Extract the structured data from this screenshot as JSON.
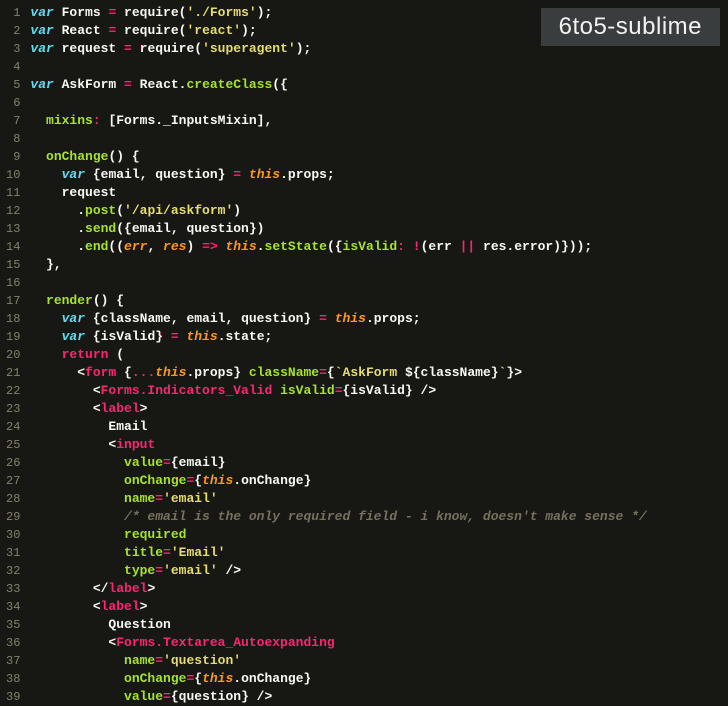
{
  "badge": "6to5-sublime",
  "lines": [
    {
      "n": 1,
      "tokens": [
        [
          "st",
          "var "
        ],
        [
          "nm",
          "Forms "
        ],
        [
          "op",
          "="
        ],
        [
          "nm",
          " require("
        ],
        [
          "str",
          "'./Forms'"
        ],
        [
          "nm",
          ");"
        ]
      ]
    },
    {
      "n": 2,
      "tokens": [
        [
          "st",
          "var "
        ],
        [
          "nm",
          "React "
        ],
        [
          "op",
          "="
        ],
        [
          "nm",
          " require("
        ],
        [
          "str",
          "'react'"
        ],
        [
          "nm",
          ");"
        ]
      ]
    },
    {
      "n": 3,
      "tokens": [
        [
          "st",
          "var "
        ],
        [
          "nm",
          "request "
        ],
        [
          "op",
          "="
        ],
        [
          "nm",
          " require("
        ],
        [
          "str",
          "'superagent'"
        ],
        [
          "nm",
          ");"
        ]
      ]
    },
    {
      "n": 4,
      "tokens": [
        [
          "nm",
          ""
        ]
      ]
    },
    {
      "n": 5,
      "tokens": [
        [
          "st",
          "var "
        ],
        [
          "nm",
          "AskForm "
        ],
        [
          "op",
          "="
        ],
        [
          "nm",
          " React."
        ],
        [
          "fn",
          "createClass"
        ],
        [
          "nm",
          "({"
        ]
      ]
    },
    {
      "n": 6,
      "tokens": [
        [
          "nm",
          ""
        ]
      ]
    },
    {
      "n": 7,
      "tokens": [
        [
          "nm",
          "  "
        ],
        [
          "fn",
          "mixins"
        ],
        [
          "op",
          ":"
        ],
        [
          "nm",
          " [Forms._InputsMixin],"
        ]
      ]
    },
    {
      "n": 8,
      "tokens": [
        [
          "nm",
          ""
        ]
      ]
    },
    {
      "n": 9,
      "tokens": [
        [
          "nm",
          "  "
        ],
        [
          "fn",
          "onChange"
        ],
        [
          "nm",
          "() {"
        ]
      ]
    },
    {
      "n": 10,
      "tokens": [
        [
          "nm",
          "    "
        ],
        [
          "st",
          "var "
        ],
        [
          "nm",
          "{email, question} "
        ],
        [
          "op",
          "="
        ],
        [
          "nm",
          " "
        ],
        [
          "thiskw",
          "this"
        ],
        [
          "nm",
          ".props;"
        ]
      ]
    },
    {
      "n": 11,
      "tokens": [
        [
          "nm",
          "    request"
        ]
      ]
    },
    {
      "n": 12,
      "tokens": [
        [
          "nm",
          "      ."
        ],
        [
          "fn",
          "post"
        ],
        [
          "nm",
          "("
        ],
        [
          "str",
          "'/api/askform'"
        ],
        [
          "nm",
          ")"
        ]
      ]
    },
    {
      "n": 13,
      "tokens": [
        [
          "nm",
          "      ."
        ],
        [
          "fn",
          "send"
        ],
        [
          "nm",
          "({email, question})"
        ]
      ]
    },
    {
      "n": 14,
      "tokens": [
        [
          "nm",
          "      ."
        ],
        [
          "fn",
          "end"
        ],
        [
          "nm",
          "(("
        ],
        [
          "thiskw",
          "err"
        ],
        [
          "nm",
          ", "
        ],
        [
          "thiskw",
          "res"
        ],
        [
          "nm",
          ") "
        ],
        [
          "op",
          "=>"
        ],
        [
          "nm",
          " "
        ],
        [
          "thiskw",
          "this"
        ],
        [
          "nm",
          "."
        ],
        [
          "fn",
          "setState"
        ],
        [
          "nm",
          "({"
        ],
        [
          "fn",
          "isValid"
        ],
        [
          "op",
          ":"
        ],
        [
          "nm",
          " "
        ],
        [
          "op",
          "!"
        ],
        [
          "nm",
          "(err "
        ],
        [
          "op",
          "||"
        ],
        [
          "nm",
          " res.error)}));"
        ]
      ]
    },
    {
      "n": 15,
      "tokens": [
        [
          "nm",
          "  },"
        ]
      ]
    },
    {
      "n": 16,
      "tokens": [
        [
          "nm",
          ""
        ]
      ]
    },
    {
      "n": 17,
      "tokens": [
        [
          "nm",
          "  "
        ],
        [
          "fn",
          "render"
        ],
        [
          "nm",
          "() {"
        ]
      ]
    },
    {
      "n": 18,
      "tokens": [
        [
          "nm",
          "    "
        ],
        [
          "st",
          "var "
        ],
        [
          "nm",
          "{className, email, question} "
        ],
        [
          "op",
          "="
        ],
        [
          "nm",
          " "
        ],
        [
          "thiskw",
          "this"
        ],
        [
          "nm",
          ".props;"
        ]
      ]
    },
    {
      "n": 19,
      "tokens": [
        [
          "nm",
          "    "
        ],
        [
          "st",
          "var "
        ],
        [
          "nm",
          "{isValid} "
        ],
        [
          "op",
          "="
        ],
        [
          "nm",
          " "
        ],
        [
          "thiskw",
          "this"
        ],
        [
          "nm",
          ".state;"
        ]
      ]
    },
    {
      "n": 20,
      "tokens": [
        [
          "nm",
          "    "
        ],
        [
          "op",
          "return"
        ],
        [
          "nm",
          " ("
        ]
      ]
    },
    {
      "n": 21,
      "tokens": [
        [
          "nm",
          "      <"
        ],
        [
          "tag",
          "form"
        ],
        [
          "nm",
          " {"
        ],
        [
          "op",
          "..."
        ],
        [
          "thiskw",
          "this"
        ],
        [
          "nm",
          ".props} "
        ],
        [
          "attr",
          "className"
        ],
        [
          "op",
          "="
        ],
        [
          "nm",
          "{"
        ],
        [
          "str",
          "`AskForm "
        ],
        [
          "nm",
          "${className}"
        ],
        [
          "str",
          "`"
        ],
        [
          "nm",
          "}>"
        ]
      ]
    },
    {
      "n": 22,
      "tokens": [
        [
          "nm",
          "        <"
        ],
        [
          "tag",
          "Forms.Indicators_Valid"
        ],
        [
          "nm",
          " "
        ],
        [
          "attr",
          "isValid"
        ],
        [
          "op",
          "="
        ],
        [
          "nm",
          "{isValid} />"
        ]
      ]
    },
    {
      "n": 23,
      "tokens": [
        [
          "nm",
          "        <"
        ],
        [
          "tag",
          "label"
        ],
        [
          "nm",
          ">"
        ]
      ]
    },
    {
      "n": 24,
      "tokens": [
        [
          "nm",
          "          Email"
        ]
      ]
    },
    {
      "n": 25,
      "tokens": [
        [
          "nm",
          "          <"
        ],
        [
          "tag",
          "input"
        ]
      ]
    },
    {
      "n": 26,
      "tokens": [
        [
          "nm",
          "            "
        ],
        [
          "attr",
          "value"
        ],
        [
          "op",
          "="
        ],
        [
          "nm",
          "{email}"
        ]
      ]
    },
    {
      "n": 27,
      "tokens": [
        [
          "nm",
          "            "
        ],
        [
          "attr",
          "onChange"
        ],
        [
          "op",
          "="
        ],
        [
          "nm",
          "{"
        ],
        [
          "thiskw",
          "this"
        ],
        [
          "nm",
          ".onChange}"
        ]
      ]
    },
    {
      "n": 28,
      "tokens": [
        [
          "nm",
          "            "
        ],
        [
          "attr",
          "name"
        ],
        [
          "op",
          "="
        ],
        [
          "str",
          "'email'"
        ]
      ]
    },
    {
      "n": 29,
      "tokens": [
        [
          "nm",
          "            "
        ],
        [
          "cm",
          "/* email is the only required field - i know, doesn't make sense */"
        ]
      ]
    },
    {
      "n": 30,
      "tokens": [
        [
          "nm",
          "            "
        ],
        [
          "attr",
          "required"
        ]
      ]
    },
    {
      "n": 31,
      "tokens": [
        [
          "nm",
          "            "
        ],
        [
          "attr",
          "title"
        ],
        [
          "op",
          "="
        ],
        [
          "str",
          "'Email'"
        ]
      ]
    },
    {
      "n": 32,
      "tokens": [
        [
          "nm",
          "            "
        ],
        [
          "attr",
          "type"
        ],
        [
          "op",
          "="
        ],
        [
          "str",
          "'email'"
        ],
        [
          "nm",
          " />"
        ]
      ]
    },
    {
      "n": 33,
      "tokens": [
        [
          "nm",
          "        </"
        ],
        [
          "tag",
          "label"
        ],
        [
          "nm",
          ">"
        ]
      ]
    },
    {
      "n": 34,
      "tokens": [
        [
          "nm",
          "        <"
        ],
        [
          "tag",
          "label"
        ],
        [
          "nm",
          ">"
        ]
      ]
    },
    {
      "n": 35,
      "tokens": [
        [
          "nm",
          "          Question"
        ]
      ]
    },
    {
      "n": 36,
      "tokens": [
        [
          "nm",
          "          <"
        ],
        [
          "tag",
          "Forms.Textarea_Autoexpanding"
        ]
      ]
    },
    {
      "n": 37,
      "tokens": [
        [
          "nm",
          "            "
        ],
        [
          "attr",
          "name"
        ],
        [
          "op",
          "="
        ],
        [
          "str",
          "'question'"
        ]
      ]
    },
    {
      "n": 38,
      "tokens": [
        [
          "nm",
          "            "
        ],
        [
          "attr",
          "onChange"
        ],
        [
          "op",
          "="
        ],
        [
          "nm",
          "{"
        ],
        [
          "thiskw",
          "this"
        ],
        [
          "nm",
          ".onChange}"
        ]
      ]
    },
    {
      "n": 39,
      "tokens": [
        [
          "nm",
          "            "
        ],
        [
          "attr",
          "value"
        ],
        [
          "op",
          "="
        ],
        [
          "nm",
          "{question} />"
        ]
      ]
    }
  ]
}
